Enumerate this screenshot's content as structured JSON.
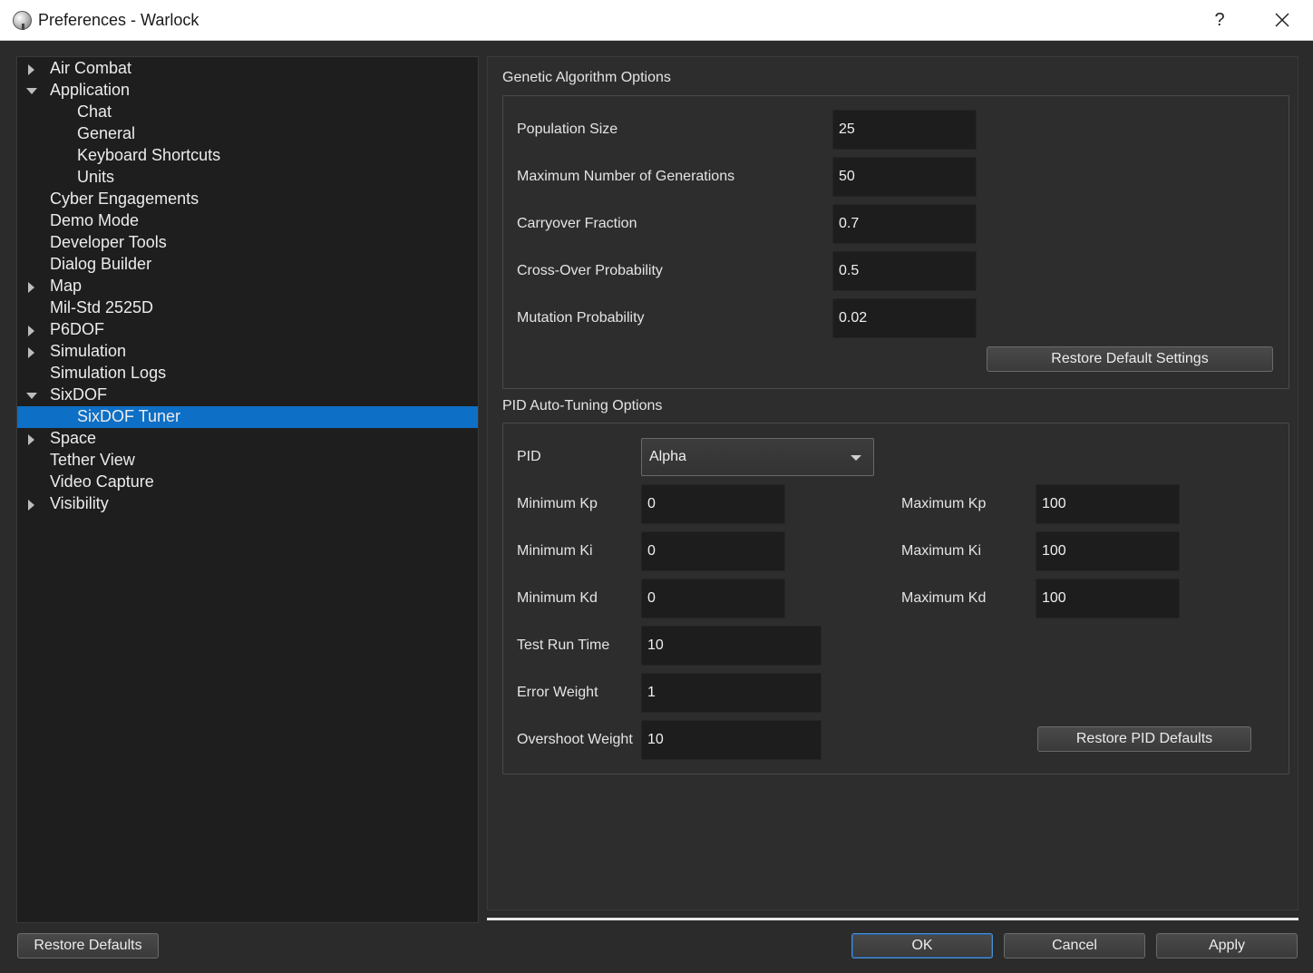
{
  "window": {
    "title": "Preferences - Warlock",
    "help_label": "?"
  },
  "tree": {
    "items": [
      {
        "label": "Air Combat",
        "level": 0,
        "expander": "collapsed",
        "selected": false
      },
      {
        "label": "Application",
        "level": 0,
        "expander": "expanded",
        "selected": false
      },
      {
        "label": "Chat",
        "level": 1,
        "expander": "none",
        "selected": false
      },
      {
        "label": "General",
        "level": 1,
        "expander": "none",
        "selected": false
      },
      {
        "label": "Keyboard Shortcuts",
        "level": 1,
        "expander": "none",
        "selected": false
      },
      {
        "label": "Units",
        "level": 1,
        "expander": "none",
        "selected": false
      },
      {
        "label": "Cyber Engagements",
        "level": 0,
        "expander": "none",
        "selected": false
      },
      {
        "label": "Demo Mode",
        "level": 0,
        "expander": "none",
        "selected": false
      },
      {
        "label": "Developer Tools",
        "level": 0,
        "expander": "none",
        "selected": false
      },
      {
        "label": "Dialog Builder",
        "level": 0,
        "expander": "none",
        "selected": false
      },
      {
        "label": "Map",
        "level": 0,
        "expander": "collapsed",
        "selected": false
      },
      {
        "label": "Mil-Std 2525D",
        "level": 0,
        "expander": "none",
        "selected": false
      },
      {
        "label": "P6DOF",
        "level": 0,
        "expander": "collapsed",
        "selected": false
      },
      {
        "label": "Simulation",
        "level": 0,
        "expander": "collapsed",
        "selected": false
      },
      {
        "label": "Simulation Logs",
        "level": 0,
        "expander": "none",
        "selected": false
      },
      {
        "label": "SixDOF",
        "level": 0,
        "expander": "expanded",
        "selected": false
      },
      {
        "label": "SixDOF Tuner",
        "level": 1,
        "expander": "none",
        "selected": true
      },
      {
        "label": "Space",
        "level": 0,
        "expander": "collapsed",
        "selected": false
      },
      {
        "label": "Tether View",
        "level": 0,
        "expander": "none",
        "selected": false
      },
      {
        "label": "Video Capture",
        "level": 0,
        "expander": "none",
        "selected": false
      },
      {
        "label": "Visibility",
        "level": 0,
        "expander": "collapsed",
        "selected": false
      }
    ]
  },
  "genetic": {
    "title": "Genetic Algorithm Options",
    "fields": [
      {
        "label": "Population Size",
        "value": "25"
      },
      {
        "label": "Maximum Number of Generations",
        "value": "50"
      },
      {
        "label": "Carryover Fraction",
        "value": "0.7"
      },
      {
        "label": "Cross-Over Probability",
        "value": "0.5"
      },
      {
        "label": "Mutation Probability",
        "value": "0.02"
      }
    ],
    "restore_label": "Restore Default Settings"
  },
  "pid": {
    "title": "PID Auto-Tuning Options",
    "pid_label": "PID",
    "pid_value": "Alpha",
    "min_kp_label": "Minimum Kp",
    "min_kp": "0",
    "max_kp_label": "Maximum Kp",
    "max_kp": "100",
    "min_ki_label": "Minimum Ki",
    "min_ki": "0",
    "max_ki_label": "Maximum Ki",
    "max_ki": "100",
    "min_kd_label": "Minimum Kd",
    "min_kd": "0",
    "max_kd_label": "Maximum Kd",
    "max_kd": "100",
    "test_run_label": "Test Run Time",
    "test_run": "10",
    "error_weight_label": "Error Weight",
    "error_weight": "1",
    "overshoot_label": "Overshoot Weight",
    "overshoot": "10",
    "restore_label": "Restore PID Defaults"
  },
  "footer": {
    "restore_defaults": "Restore Defaults",
    "ok": "OK",
    "cancel": "Cancel",
    "apply": "Apply"
  },
  "colors": {
    "selection": "#0d6fc5",
    "background": "#2b2b2b",
    "input_background": "#1d1d1d"
  }
}
